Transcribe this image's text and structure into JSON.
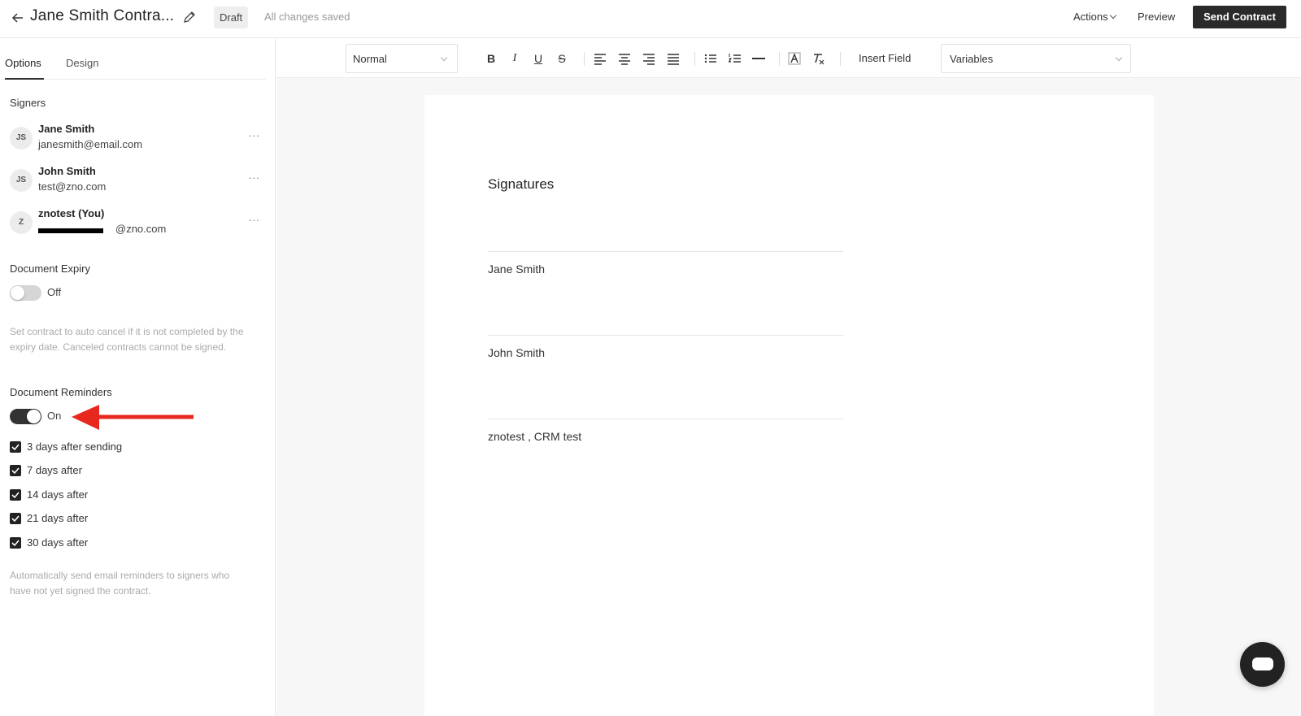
{
  "header": {
    "title": "Jane Smith Contra...",
    "status_badge": "Draft",
    "save_status": "All changes saved",
    "actions_label": "Actions",
    "preview_label": "Preview",
    "send_label": "Send Contract"
  },
  "sidebar": {
    "tabs": [
      {
        "label": "Options",
        "active": true
      },
      {
        "label": "Design",
        "active": false
      }
    ],
    "signers_label": "Signers",
    "signers": [
      {
        "initials": "JS",
        "name": "Jane Smith",
        "email": "janesmith@email.com"
      },
      {
        "initials": "JS",
        "name": "John Smith",
        "email": "test@zno.com"
      },
      {
        "initials": "Z",
        "name": "znotest (You)",
        "email": "@zno.com"
      }
    ],
    "more_label": "...",
    "expiry": {
      "label": "Document Expiry",
      "state_label": "Off",
      "enabled": false,
      "help": "Set contract to auto cancel if it is not completed by the expiry date. Canceled contracts cannot be signed."
    },
    "reminders": {
      "label": "Document Reminders",
      "state_label": "On",
      "enabled": true,
      "options": [
        {
          "label": "3 days after sending",
          "checked": true
        },
        {
          "label": "7 days after",
          "checked": true
        },
        {
          "label": "14 days after",
          "checked": true
        },
        {
          "label": "21 days after",
          "checked": true
        },
        {
          "label": "30 days after",
          "checked": true
        }
      ],
      "help": "Automatically send email reminders to signers who have not yet signed the contract."
    }
  },
  "toolbar": {
    "style_select": "Normal",
    "insert_field_label": "Insert Field",
    "variables_select": "Variables",
    "icons": [
      "bold-icon",
      "italic-icon",
      "underline-icon",
      "strikethrough-icon",
      "align-left-icon",
      "align-center-icon",
      "align-right-icon",
      "align-justify-icon",
      "bullet-list-icon",
      "numbered-list-icon",
      "horizontal-rule-icon",
      "text-color-icon",
      "clear-format-icon"
    ]
  },
  "document": {
    "heading": "Signatures",
    "signature_blocks": [
      {
        "name": "Jane Smith"
      },
      {
        "name": "John Smith"
      },
      {
        "name": "znotest , CRM test"
      }
    ]
  },
  "colors": {
    "primary_dark": "#2a2a2a",
    "annotation_arrow": "#e8281e",
    "muted_text": "#aaaaaa"
  }
}
